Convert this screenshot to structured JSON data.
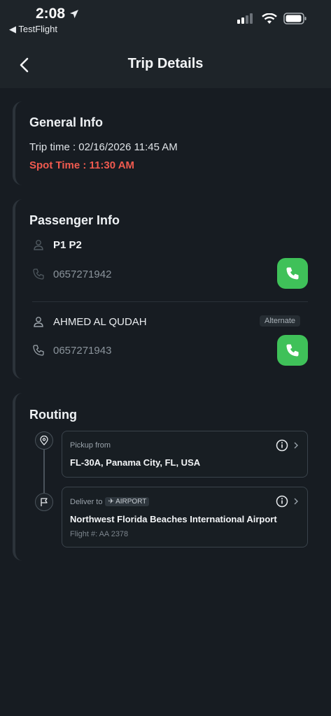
{
  "status_bar": {
    "time": "2:08",
    "back_app": "◀ TestFlight"
  },
  "header": {
    "title": "Trip Details"
  },
  "general": {
    "title": "General Info",
    "trip_time": "Trip time : 02/16/2026 11:45 AM",
    "spot_time": "Spot Time : 11:30 AM"
  },
  "passenger": {
    "title": "Passenger Info",
    "items": [
      {
        "name": "P1 P2",
        "phone": "0657271942"
      },
      {
        "name": "AHMED AL QUDAH",
        "phone": "0657271943",
        "badge": "Alternate"
      }
    ]
  },
  "routing": {
    "title": "Routing",
    "pickup": {
      "label": "Pickup from",
      "address": "FL-30A, Panama City, FL, USA"
    },
    "deliver": {
      "label": "Deliver to",
      "tag": "AIRPORT",
      "name": "Northwest Florida Beaches International Airport",
      "flight": "Flight #: AA 2378"
    }
  },
  "colors": {
    "accent_call": "#3fc159",
    "spot_time": "#f05a4f",
    "background": "#171c22"
  },
  "icons": [
    "location-arrow-icon",
    "signal-icon",
    "wifi-icon",
    "battery-icon",
    "back-chevron-icon",
    "person-icon",
    "phone-icon",
    "call-icon",
    "pin-icon",
    "flag-icon",
    "info-icon",
    "chevron-right-icon",
    "plane-icon"
  ]
}
